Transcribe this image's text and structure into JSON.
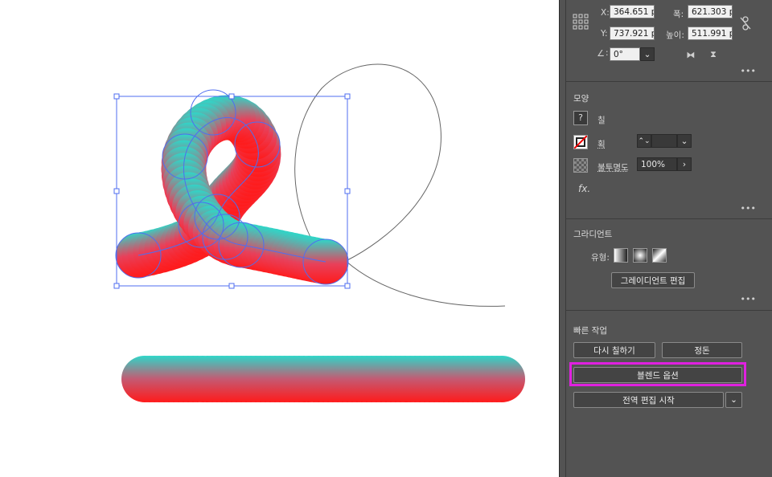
{
  "transform": {
    "x_label": "X:",
    "x_value": "364.651 p",
    "y_label": "Y:",
    "y_value": "737.921 p",
    "w_label": "폭:",
    "w_value": "621.303 p",
    "h_label": "높이:",
    "h_value": "511.991 p",
    "angle_value": "0°"
  },
  "appearance": {
    "title": "모양",
    "fill_label": "칠",
    "stroke_label": "획",
    "opacity_label": "불투명도",
    "opacity_value": "100%",
    "fx_label": "fx."
  },
  "gradient": {
    "title": "그라디언트",
    "type_label": "유형:",
    "edit_button": "그레이디언트 편집"
  },
  "quick_actions": {
    "title": "빠른 작업",
    "recolor_button": "다시 칠하기",
    "arrange_button": "정돈",
    "blend_options_button": "블렌드 옵션",
    "global_edit_button": "전역 편집 시작"
  },
  "more_glyph": "•••",
  "colors": {
    "panel_bg": "#535353",
    "highlight": "#e020e0",
    "selection": "#4f6ef0",
    "blend_start": "#2fd6c8",
    "blend_end": "#ff1a1a"
  }
}
